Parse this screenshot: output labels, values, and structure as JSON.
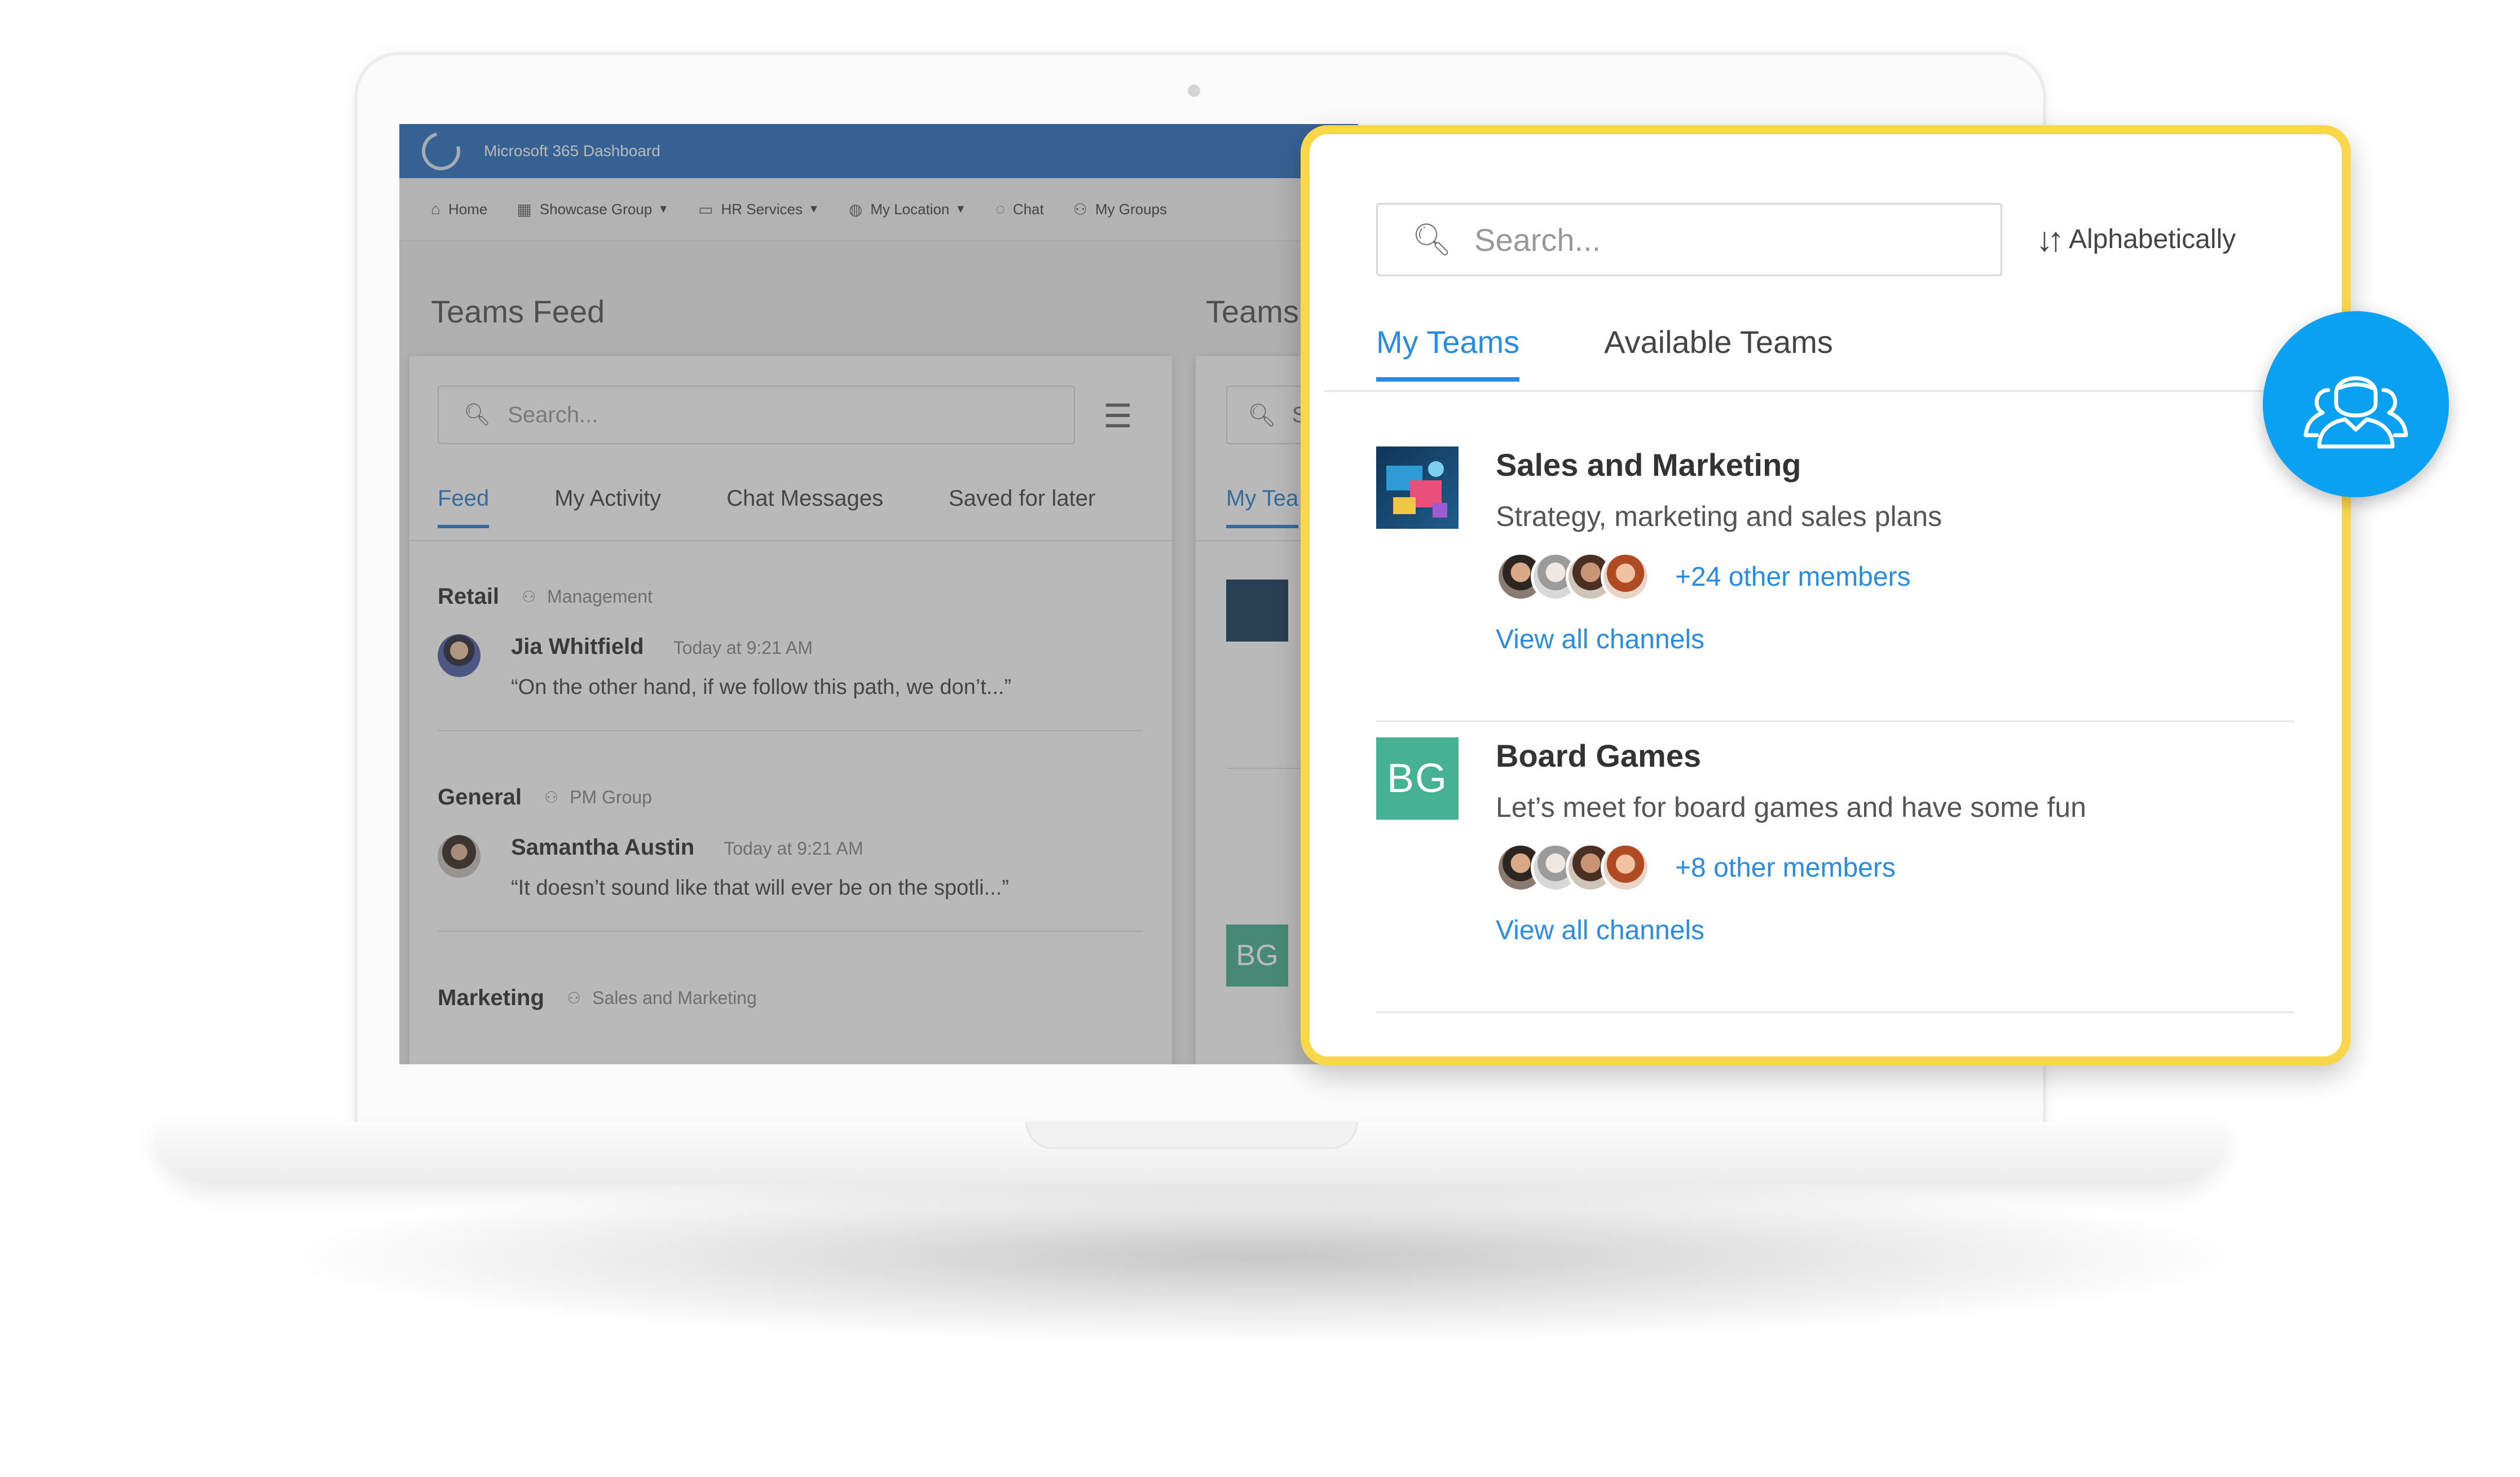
{
  "app": {
    "title": "Microsoft 365 Dashboard"
  },
  "nav": {
    "items": [
      {
        "label": "Home",
        "icon": "home-icon"
      },
      {
        "label": "Showcase Group",
        "icon": "building-icon",
        "dropdown": true
      },
      {
        "label": "HR Services",
        "icon": "folder-icon",
        "dropdown": true
      },
      {
        "label": "My Location",
        "icon": "globe-icon",
        "dropdown": true
      },
      {
        "label": "Chat",
        "icon": "chat-icon"
      },
      {
        "label": "My Groups",
        "icon": "groups-icon"
      }
    ]
  },
  "feed": {
    "heading": "Teams Feed",
    "search_placeholder": "Search...",
    "tabs": [
      "Feed",
      "My Activity",
      "Chat Messages",
      "Saved for later"
    ],
    "groups": [
      {
        "name": "Retail",
        "team": "Management",
        "author": "Jia Whitfield",
        "time": "Today at 9:21 AM",
        "text": "“On the other hand, if we follow this path, we don’t...”"
      },
      {
        "name": "General",
        "team": "PM Group",
        "author": "Samantha Austin",
        "time": "Today at 9:21 AM",
        "text": "“It doesn’t sound like that will ever be on the spotli...”"
      },
      {
        "name": "Marketing",
        "team": "Sales and Marketing"
      }
    ]
  },
  "teams_bg": {
    "heading": "Teams",
    "search_partial": "S",
    "tab_partial": "My Tea",
    "bg_initials": "BG"
  },
  "zoom": {
    "search_placeholder": "Search...",
    "sort_label": "Alphabetically",
    "tabs": [
      "My Teams",
      "Available Teams"
    ],
    "teams": [
      {
        "name": "Sales and Marketing",
        "description": "Strategy, marketing and sales plans",
        "members": "+24 other members",
        "link": "View all channels"
      },
      {
        "name": "Board Games",
        "description": "Let’s meet for board games and have some fun",
        "members": "+8 other members",
        "link": "View all channels",
        "initials": "BG"
      }
    ]
  },
  "colors": {
    "topbar": "#2d73c2",
    "accent_blue": "#2a8ce0",
    "highlight_yellow": "#f8d84a",
    "badge_blue": "#0aa1f3",
    "team_green": "#46b293"
  }
}
